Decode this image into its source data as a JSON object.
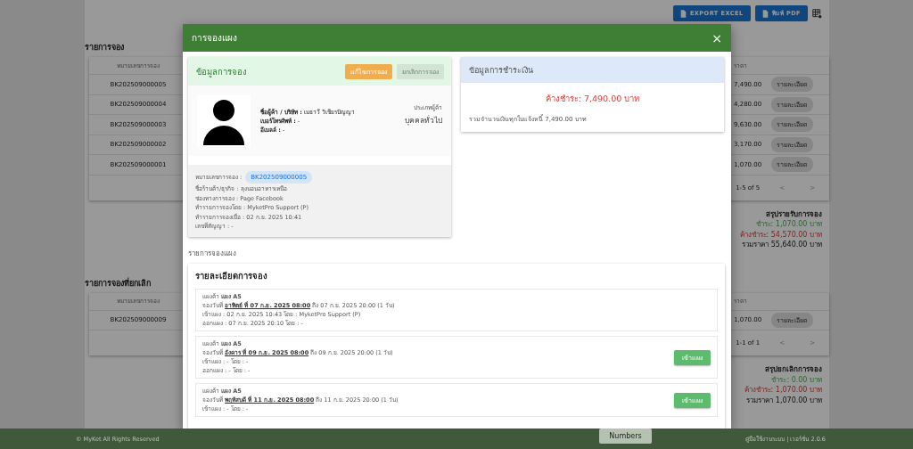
{
  "toolbar": {
    "buttons": [
      {
        "label": "EXPORT EXCEL"
      },
      {
        "label": "พิมพ์ PDF"
      }
    ]
  },
  "sections": [
    {
      "title": "รายการจอง",
      "columns": {
        "column_1": "หมายเลขการจอง",
        "column_3": "ราคา"
      },
      "rows": [
        {
          "booking": "BK202509000005",
          "price": "7,490.00",
          "action": "รายละเอียด"
        },
        {
          "booking": "BK202509000004",
          "price": "4,280.00",
          "action": "รายละเอียด"
        },
        {
          "booking": "BK202509000003",
          "price": "9,630.00",
          "action": "รายละเอียด"
        },
        {
          "booking": "BK202509000002",
          "price": "3,170.00",
          "action": "รายละเอียด"
        },
        {
          "booking": "BK202509000001",
          "price": "1,070.00",
          "action": "รายละเอียด"
        }
      ],
      "pagination": {
        "range": "1-5 of 5",
        "prev": "<",
        "next": ">"
      },
      "summary": {
        "title": "สรุปรายรับการจอง",
        "paid": "ชำระ: 1,070.00 บาท",
        "outstanding": "ค้างชำระ: 54,570.00 บาท",
        "total": "รวมราคา 55,640.00 บาท"
      }
    },
    {
      "title": "รายการจองที่ยกเลิก",
      "columns": {
        "column_1": "หมายเลขการจอง",
        "column_3": "ราคา"
      },
      "rows": [
        {
          "booking": "BK202509000009",
          "price": "1,070.00",
          "action": "รายละเอียด"
        }
      ],
      "pagination": {
        "range": "1-1 of 1",
        "prev": "<",
        "next": ">"
      },
      "summary": {
        "title": "สรุปยกเลิกการจอง",
        "paid": "ชำระ: 0.00 บาท",
        "outstanding": "ค้างชำระ: 1,070.00 บาท",
        "total": "รวมราคา 1,070.00 บาท"
      }
    }
  ],
  "modal": {
    "title": "การจองแผง",
    "close": "×",
    "booking_info": {
      "title": "ข้อมูลการจอง",
      "buttons": [
        {
          "label": "แก้ไขการจอง",
          "kind": "warning",
          "disabled": false
        },
        {
          "label": "ยกเลิกการจอง",
          "kind": "danger",
          "disabled": true
        }
      ],
      "customer": [
        "**ชื่อผู้ค้า / บริษัท :** เมธาวี วิเชียรปัญญา",
        "**เบอร์โทรศัพท์ :** -",
        "**อีเมลล์ :** -"
      ],
      "customer_type_label": "ประเภทผู้ค้า",
      "customer_type": "บุคคลทั่วไป",
      "booking_number_label": "หมายเลขการจอง :",
      "booking_number": "BK202509000005",
      "details": [
        "ชื่อร้านค้า/ธุรกิจ : ลุงนอนอาหารเหนือ",
        "ช่องทางการจอง : Page Facebook",
        "ทำรายการจองโดย : MyketPro Support (P)",
        "ทำรายการจองเมื่อ : 02 ก.ย. 2025 10:41",
        "เลขที่สัญญา : -"
      ]
    },
    "payment": {
      "title": "ข้อมูลการชำระเงิน",
      "outstanding": "ค้างชำระ: 7,490.00 บาท",
      "note": "รวมจำนวนเงินทุกใบแจ้งหนี้ 7,490.00 บาท"
    },
    "stalls_label": "รายการจองแผง",
    "details_card": {
      "title": "รายละเอียดการจอง",
      "items": [
        {
          "stall": "แผงค้า **แผง A5**",
          "date_label": "จองวันที่",
          "date_start": "อาทิตย์ ที่ 07 ก.ย. 2025 08:00",
          "date_end": "ถึง 07 ก.ย. 2025 20:00 (1 วัน)",
          "check_in": "เข้าแผง : 02 ก.ย. 2025 10:43 โดย : MyketPro Support (P)",
          "check_out": "ออกแผง : 07 ก.ย. 2025 20:10 โดย : -"
        },
        {
          "stall": "แผงค้า **แผง A5**",
          "date_label": "จองวันที่",
          "date_start": "อังคาร ที่ 09 ก.ย. 2025 08:00",
          "date_end": "ถึง 09 ก.ย. 2025 20:00 (1 วัน)",
          "check_in": "เข้าแผง : - โดย : -",
          "check_out": "ออกแผง : - โดย : -",
          "action": "เข้าแผง"
        },
        {
          "stall": "แผงค้า **แผง A5**",
          "date_label": "จองวันที่",
          "date_start": "พฤหัสบดี ที่ 11 ก.ย. 2025 08:00",
          "date_end": "ถึง 11 ก.ย. 2025 20:00 (1 วัน)",
          "check_in": "เข้าแผง : - โดย : -",
          "action": "เข้าแผง"
        }
      ]
    }
  },
  "footer": {
    "copyright": "© MyKet All Rights Reserved",
    "links": "คู่มือใช้งานระบบ | เวอร์ชั่น 2.0.6"
  },
  "tooltip": "Numbers"
}
